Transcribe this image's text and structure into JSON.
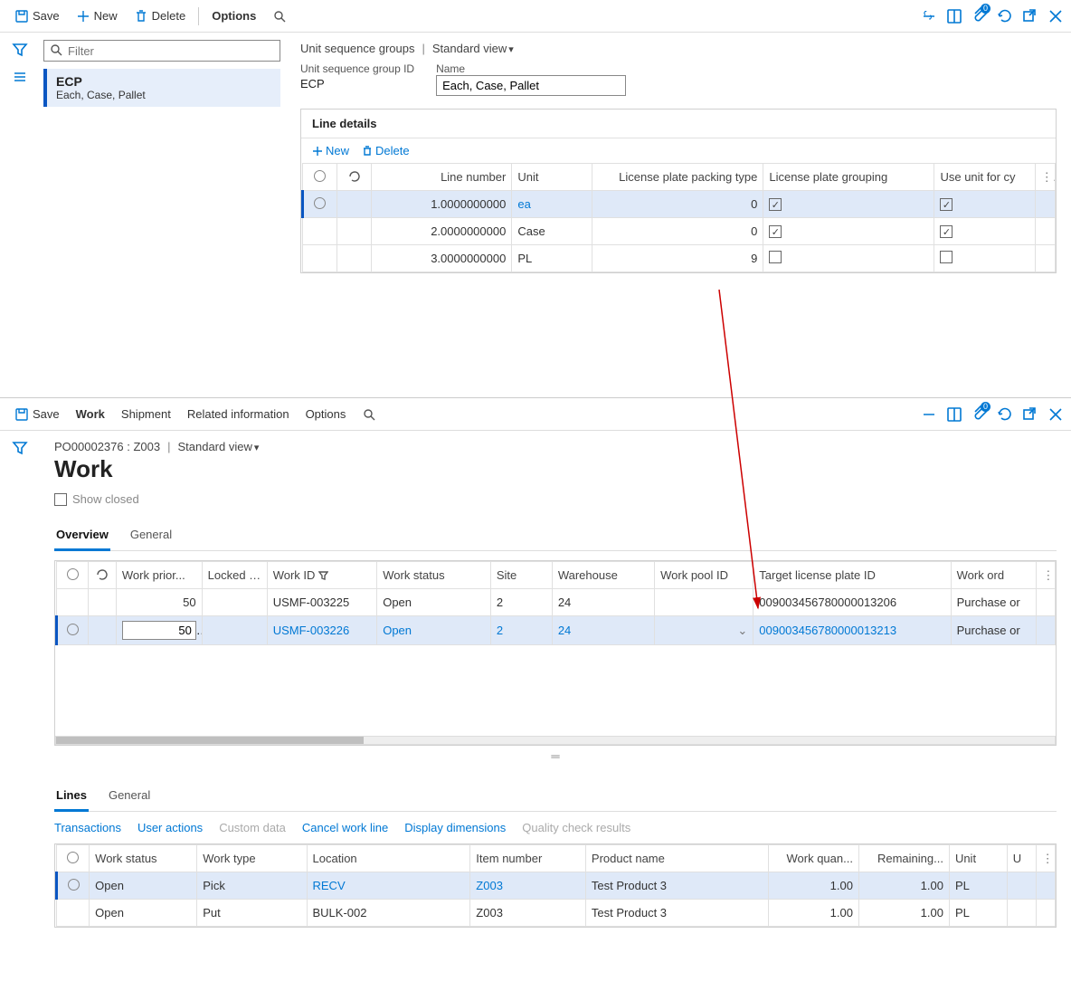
{
  "topbar1": {
    "save": "Save",
    "new": "New",
    "delete": "Delete",
    "options": "Options",
    "badge": "0"
  },
  "filter": {
    "placeholder": "Filter"
  },
  "list": {
    "title": "ECP",
    "sub": "Each, Case, Pallet"
  },
  "detail": {
    "crumb": "Unit sequence groups",
    "view": "Standard view",
    "id_label": "Unit sequence group ID",
    "id_value": "ECP",
    "name_label": "Name",
    "name_value": "Each, Case, Pallet",
    "line_section": "Line details",
    "new": "New",
    "delete": "Delete"
  },
  "lineCols": {
    "lineno": "Line number",
    "unit": "Unit",
    "lp_type": "License plate packing type",
    "lp_group": "License plate grouping",
    "use_unit": "Use unit for cy"
  },
  "lines": [
    {
      "lineno": "1.0000000000",
      "unit": "ea",
      "lp_type": "0",
      "lp_group": true,
      "use_unit": true
    },
    {
      "lineno": "2.0000000000",
      "unit": "Case",
      "lp_type": "0",
      "lp_group": true,
      "use_unit": true
    },
    {
      "lineno": "3.0000000000",
      "unit": "PL",
      "lp_type": "9",
      "lp_group": false,
      "use_unit": false
    }
  ],
  "topbar2": {
    "save": "Save",
    "work": "Work",
    "shipment": "Shipment",
    "related": "Related information",
    "options": "Options",
    "badge": "0"
  },
  "work": {
    "crumb": "PO00002376 : Z003",
    "view": "Standard view",
    "title": "Work",
    "show_closed": "Show closed",
    "tabs1": {
      "overview": "Overview",
      "general": "General"
    },
    "tabs2": {
      "lines": "Lines",
      "general": "General"
    },
    "actions": {
      "transactions": "Transactions",
      "user_actions": "User actions",
      "custom": "Custom data",
      "cancel": "Cancel work line",
      "dims": "Display dimensions",
      "quality": "Quality check results"
    }
  },
  "workCols": {
    "prio": "Work prior...",
    "locked": "Locked by",
    "work_id": "Work ID",
    "status": "Work status",
    "site": "Site",
    "wh": "Warehouse",
    "pool": "Work pool ID",
    "lp": "Target license plate ID",
    "order": "Work ord"
  },
  "workRows": [
    {
      "prio": "50",
      "locked": "",
      "work_id": "USMF-003225",
      "status": "Open",
      "site": "2",
      "wh": "24",
      "pool": "",
      "lp": "009003456780000013206",
      "order": "Purchase or"
    },
    {
      "prio": "50",
      "locked": "",
      "work_id": "USMF-003226",
      "status": "Open",
      "site": "2",
      "wh": "24",
      "pool": "",
      "lp": "009003456780000013213",
      "order": "Purchase or"
    }
  ],
  "workLineCols": {
    "status": "Work status",
    "type": "Work type",
    "loc": "Location",
    "item": "Item number",
    "product": "Product name",
    "qty": "Work quan...",
    "remain": "Remaining...",
    "unit": "Unit",
    "u": "U"
  },
  "workLines": [
    {
      "status": "Open",
      "type": "Pick",
      "loc": "RECV",
      "item": "Z003",
      "product": "Test Product 3",
      "qty": "1.00",
      "remain": "1.00",
      "unit": "PL"
    },
    {
      "status": "Open",
      "type": "Put",
      "loc": "BULK-002",
      "item": "Z003",
      "product": "Test Product 3",
      "qty": "1.00",
      "remain": "1.00",
      "unit": "PL"
    }
  ]
}
